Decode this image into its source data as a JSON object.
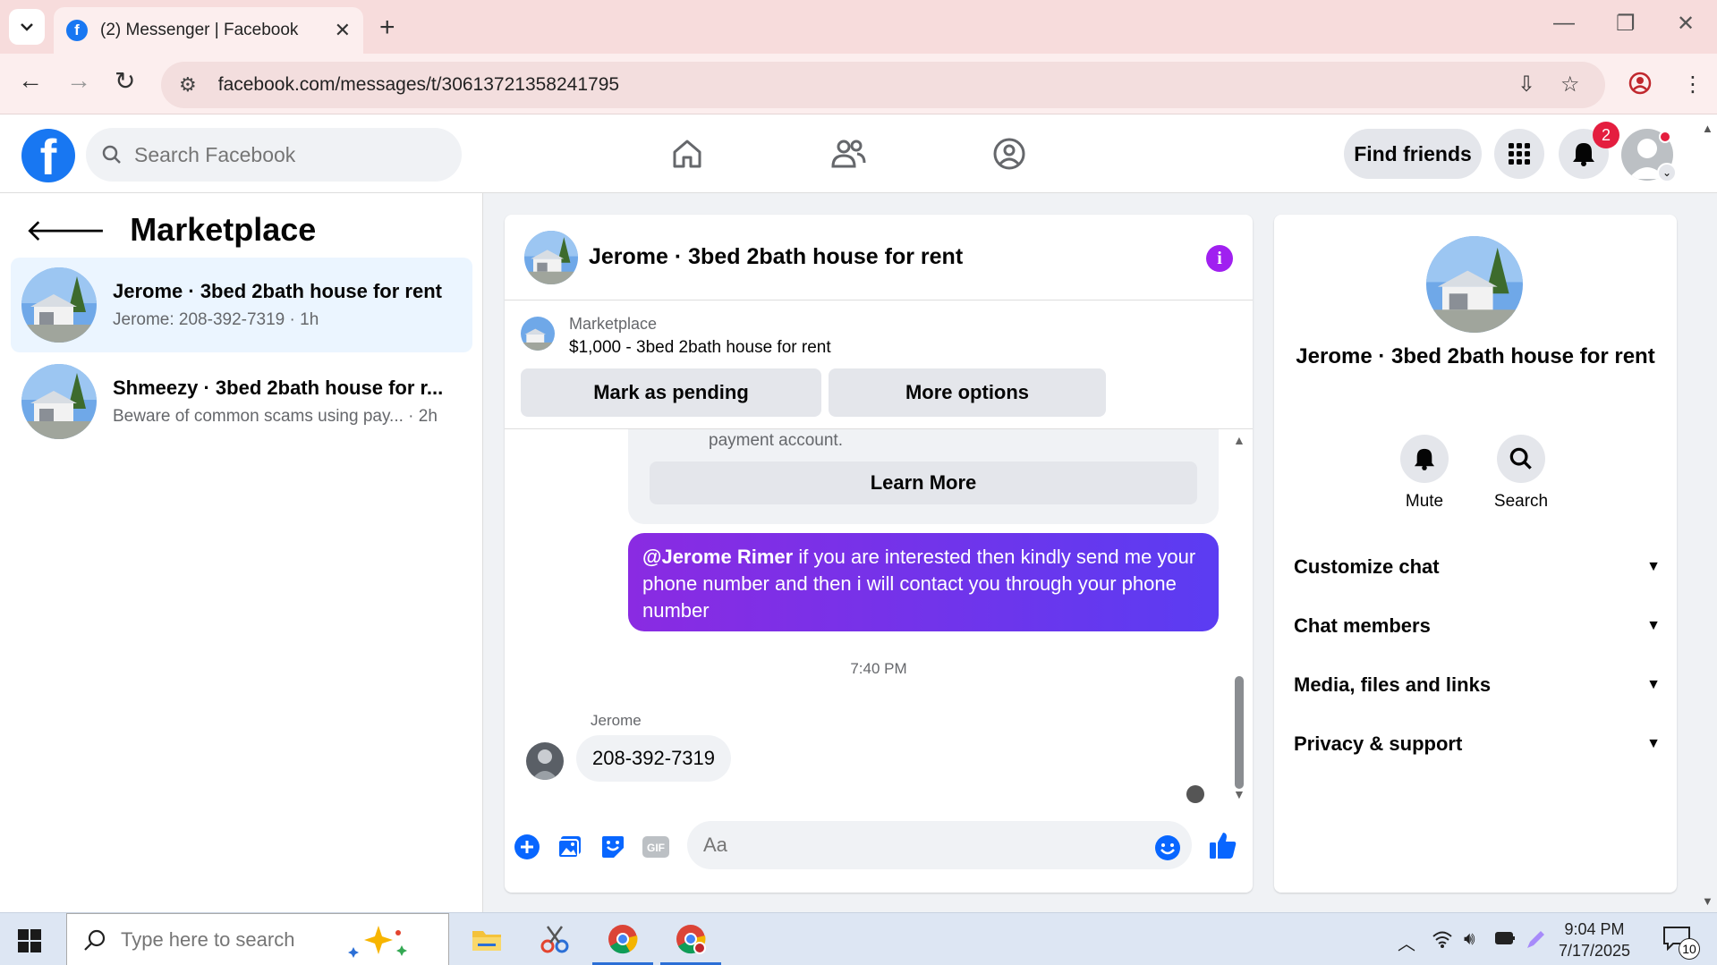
{
  "browser": {
    "tab_title": "(2) Messenger | Facebook",
    "url": "facebook.com/messages/t/30613721358241795"
  },
  "fb_header": {
    "search_placeholder": "Search Facebook",
    "find_friends_label": "Find friends",
    "notification_count": "2"
  },
  "sidebar": {
    "heading": "Marketplace",
    "conversations": [
      {
        "name": "Jerome · 3bed 2bath house for rent",
        "preview": "Jerome: 208-392-7319 · 1h"
      },
      {
        "name": "Shmeezy · 3bed 2bath house for r...",
        "preview": "Beware of common scams using pay...   · 2h"
      }
    ]
  },
  "chat": {
    "title": "Jerome · 3bed 2bath house for rent",
    "marketplace_label": "Marketplace",
    "listing": "$1,000 - 3bed 2bath house for rent",
    "mark_pending_label": "Mark as pending",
    "more_options_label": "More options",
    "scam_cut_text": "payment account.",
    "learn_more_label": "Learn More",
    "outgoing_mention": "@Jerome Rimer",
    "outgoing_text": " if you are interested then kindly send me your phone number and then i will contact you through your phone number",
    "timestamp": "7:40 PM",
    "sender_name": "Jerome",
    "incoming_text": "208-392-7319",
    "composer_placeholder": "Aa"
  },
  "info": {
    "title": "Jerome · 3bed 2bath house for rent",
    "actions": [
      "Mute",
      "Search"
    ],
    "sections": [
      "Customize chat",
      "Chat members",
      "Media, files and links",
      "Privacy & support"
    ]
  },
  "taskbar": {
    "search_placeholder": "Type here to search",
    "time": "9:04 PM",
    "date": "7/17/2025",
    "notification_count": "10"
  },
  "colors": {
    "fb_blue": "#1877f2",
    "bubble_purple": "#7b2ff7",
    "badge_red": "#e41e3f"
  }
}
